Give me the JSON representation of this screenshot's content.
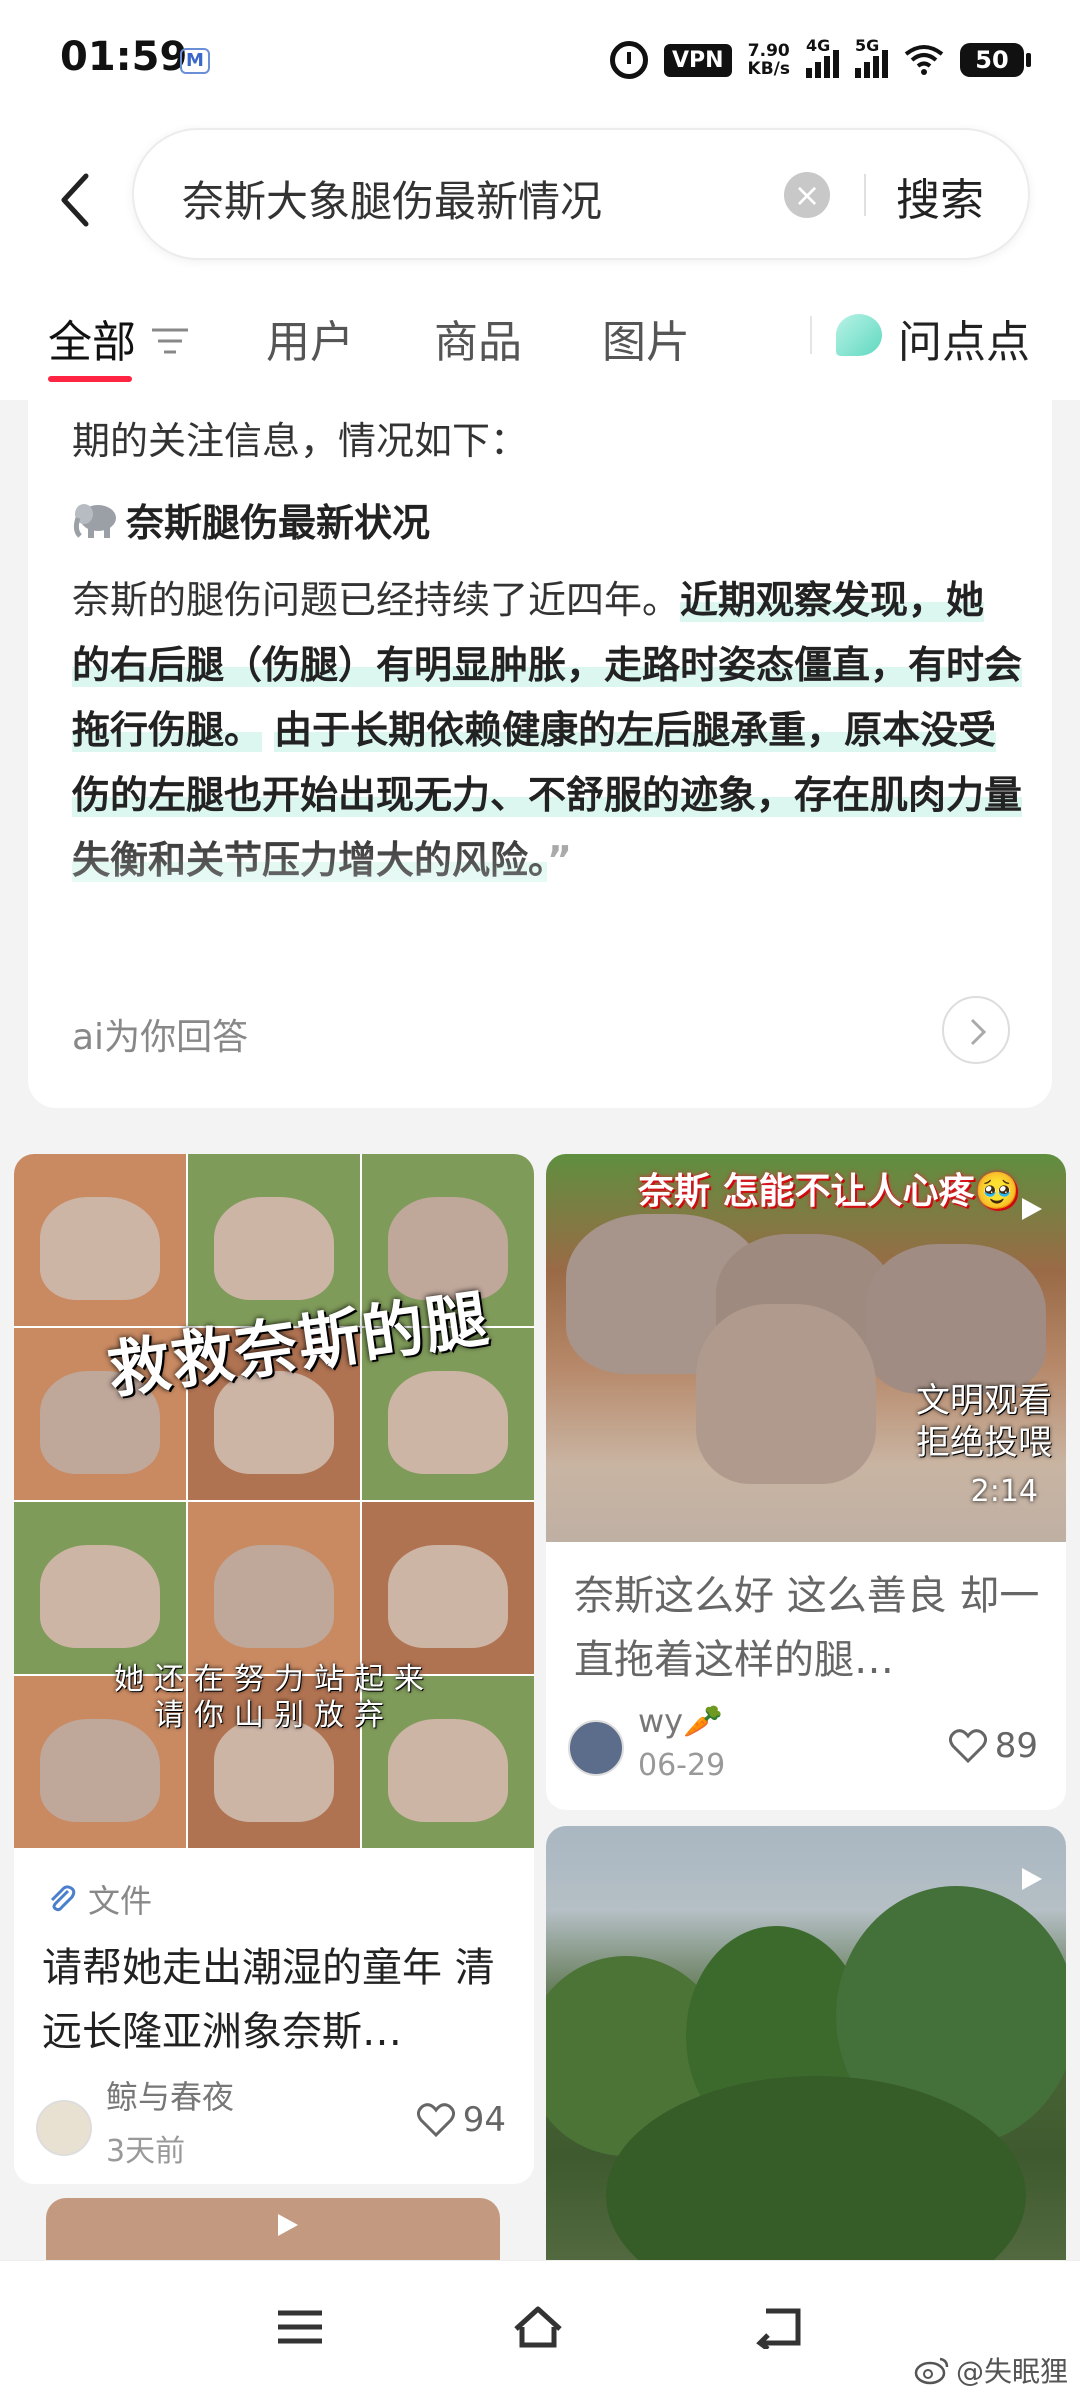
{
  "status_bar": {
    "time": "01:59",
    "app_badge": "M",
    "vpn": "VPN",
    "net_speed_value": "7.90",
    "net_speed_unit": "KB/s",
    "signal_1": "4G",
    "signal_2": "5G",
    "battery": "50"
  },
  "search": {
    "query": "奈斯大象腿伤最新情况",
    "button_label": "搜索"
  },
  "tabs": {
    "items": [
      "全部",
      "用户",
      "商品",
      "图片"
    ],
    "ask_label": "问点点"
  },
  "ai_answer": {
    "intro": "期的关注信息，情况如下：",
    "heading": "奈斯腿伤最新状况",
    "body_plain_1": "奈斯的腿伤问题已经持续了近四年。",
    "body_hl_1": "近期观察发现，她的右后腿（伤腿）有明显肿胀，走路时姿态僵直，有时会拖行伤腿。",
    "body_hl_2": "由于长期依赖健康的左后腿承重，原本没受伤的左腿也开始出现无力、不舒服的迹象，存在肌肉力量失衡和关节压力增大的风险。",
    "quote": "”",
    "footer": "ai为你回答"
  },
  "feed": {
    "left_card": {
      "thumb_caption": "救救奈斯的腿",
      "thumb_sub_1": "她还在努力站起来",
      "thumb_sub_2": "请你山别放弃",
      "label": "文件",
      "title": "请帮她走出潮湿的童年 清远长隆亚洲象奈斯…",
      "author": "鲸与春夜",
      "time": "3天前",
      "likes": "94"
    },
    "right_card_1": {
      "banner": "奈斯 怎能不让人心疼🥹",
      "overlay_1": "文明观看",
      "overlay_2": "拒绝投喂",
      "duration": "2:14",
      "title": "奈斯这么好 这么善良 却一直拖着这样的腿…",
      "author": "wy🥕",
      "time": "06-29",
      "likes": "89"
    }
  },
  "watermark": "@失眠狸",
  "colors": {
    "accent": "#ff2442",
    "highlight": "#dcf7ef"
  }
}
